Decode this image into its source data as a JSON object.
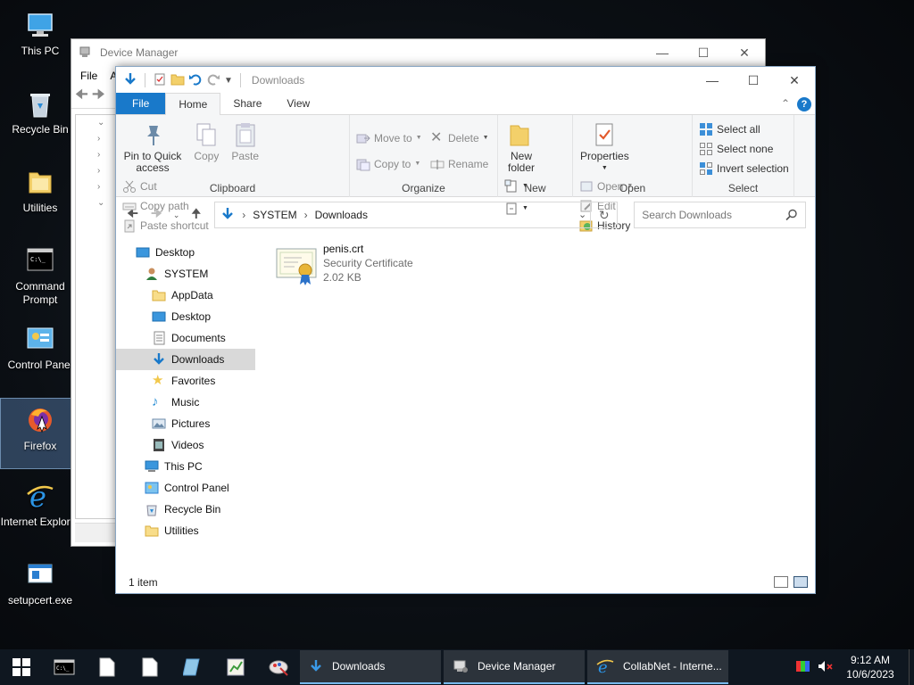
{
  "colors": {
    "accent": "#1979ca",
    "folder": "#f3d06a",
    "taskbar": "#0f1720"
  },
  "desktop": {
    "icons": [
      {
        "label": "This PC",
        "icon": "this-pc-icon"
      },
      {
        "label": "Recycle Bin",
        "icon": "recycle-bin-icon"
      },
      {
        "label": "Utilities",
        "icon": "folder-icon"
      },
      {
        "label": "Command Prompt",
        "icon": "command-prompt-icon"
      },
      {
        "label": "Control Panel",
        "icon": "control-panel-icon"
      },
      {
        "label": "Firefox",
        "icon": "firefox-icon"
      },
      {
        "label": "Internet Explorer",
        "icon": "internet-explorer-icon"
      },
      {
        "label": "setupcert.exe",
        "icon": "exe-icon"
      }
    ]
  },
  "device_manager": {
    "title": "Device Manager",
    "menu": [
      "File",
      "A"
    ]
  },
  "explorer": {
    "title": "Downloads",
    "tabs": {
      "file": "File",
      "home": "Home",
      "share": "Share",
      "view": "View"
    },
    "ribbon": {
      "clipboard": {
        "name": "Clipboard",
        "pin": "Pin to Quick access",
        "copy": "Copy",
        "paste": "Paste",
        "cut": "Cut",
        "copy_path": "Copy path",
        "paste_shortcut": "Paste shortcut"
      },
      "organize": {
        "name": "Organize",
        "move_to": "Move to",
        "copy_to": "Copy to",
        "delete": "Delete",
        "rename": "Rename"
      },
      "new": {
        "name": "New",
        "new_folder": "New folder"
      },
      "open": {
        "name": "Open",
        "properties": "Properties",
        "open": "Open",
        "edit": "Edit",
        "history": "History"
      },
      "select": {
        "name": "Select",
        "select_all": "Select all",
        "select_none": "Select none",
        "invert": "Invert selection"
      }
    },
    "address": {
      "crumbs": [
        "SYSTEM",
        "Downloads"
      ]
    },
    "search": {
      "placeholder": "Search Downloads"
    },
    "nav": [
      {
        "label": "Desktop",
        "indent": 0,
        "icon": "desktop-icon"
      },
      {
        "label": "SYSTEM",
        "indent": 1,
        "icon": "user-icon"
      },
      {
        "label": "AppData",
        "indent": 2,
        "icon": "folder-icon"
      },
      {
        "label": "Desktop",
        "indent": 2,
        "icon": "desktop-icon"
      },
      {
        "label": "Documents",
        "indent": 2,
        "icon": "documents-icon"
      },
      {
        "label": "Downloads",
        "indent": 2,
        "icon": "downloads-icon",
        "selected": true
      },
      {
        "label": "Favorites",
        "indent": 2,
        "icon": "star-icon"
      },
      {
        "label": "Music",
        "indent": 2,
        "icon": "music-icon"
      },
      {
        "label": "Pictures",
        "indent": 2,
        "icon": "pictures-icon"
      },
      {
        "label": "Videos",
        "indent": 2,
        "icon": "videos-icon"
      },
      {
        "label": "This PC",
        "indent": 1,
        "icon": "this-pc-icon"
      },
      {
        "label": "Control Panel",
        "indent": 1,
        "icon": "control-panel-icon"
      },
      {
        "label": "Recycle Bin",
        "indent": 1,
        "icon": "recycle-bin-icon"
      },
      {
        "label": "Utilities",
        "indent": 1,
        "icon": "folder-icon"
      }
    ],
    "files": [
      {
        "name": "penis.crt",
        "type": "Security Certificate",
        "size": "2.02 KB",
        "icon": "certificate-icon"
      }
    ],
    "status": "1 item"
  },
  "taskbar": {
    "pinned": [
      "command-prompt-icon",
      "document-icon",
      "document-icon",
      "notepad-icon",
      "spreadsheet-icon",
      "paint-icon"
    ],
    "buttons": [
      {
        "label": "Downloads",
        "icon": "downloads-icon"
      },
      {
        "label": "Device Manager",
        "icon": "device-manager-icon"
      },
      {
        "label": "CollabNet - Interne...",
        "icon": "internet-explorer-icon"
      }
    ],
    "time": "9:12 AM",
    "date": "10/6/2023"
  }
}
